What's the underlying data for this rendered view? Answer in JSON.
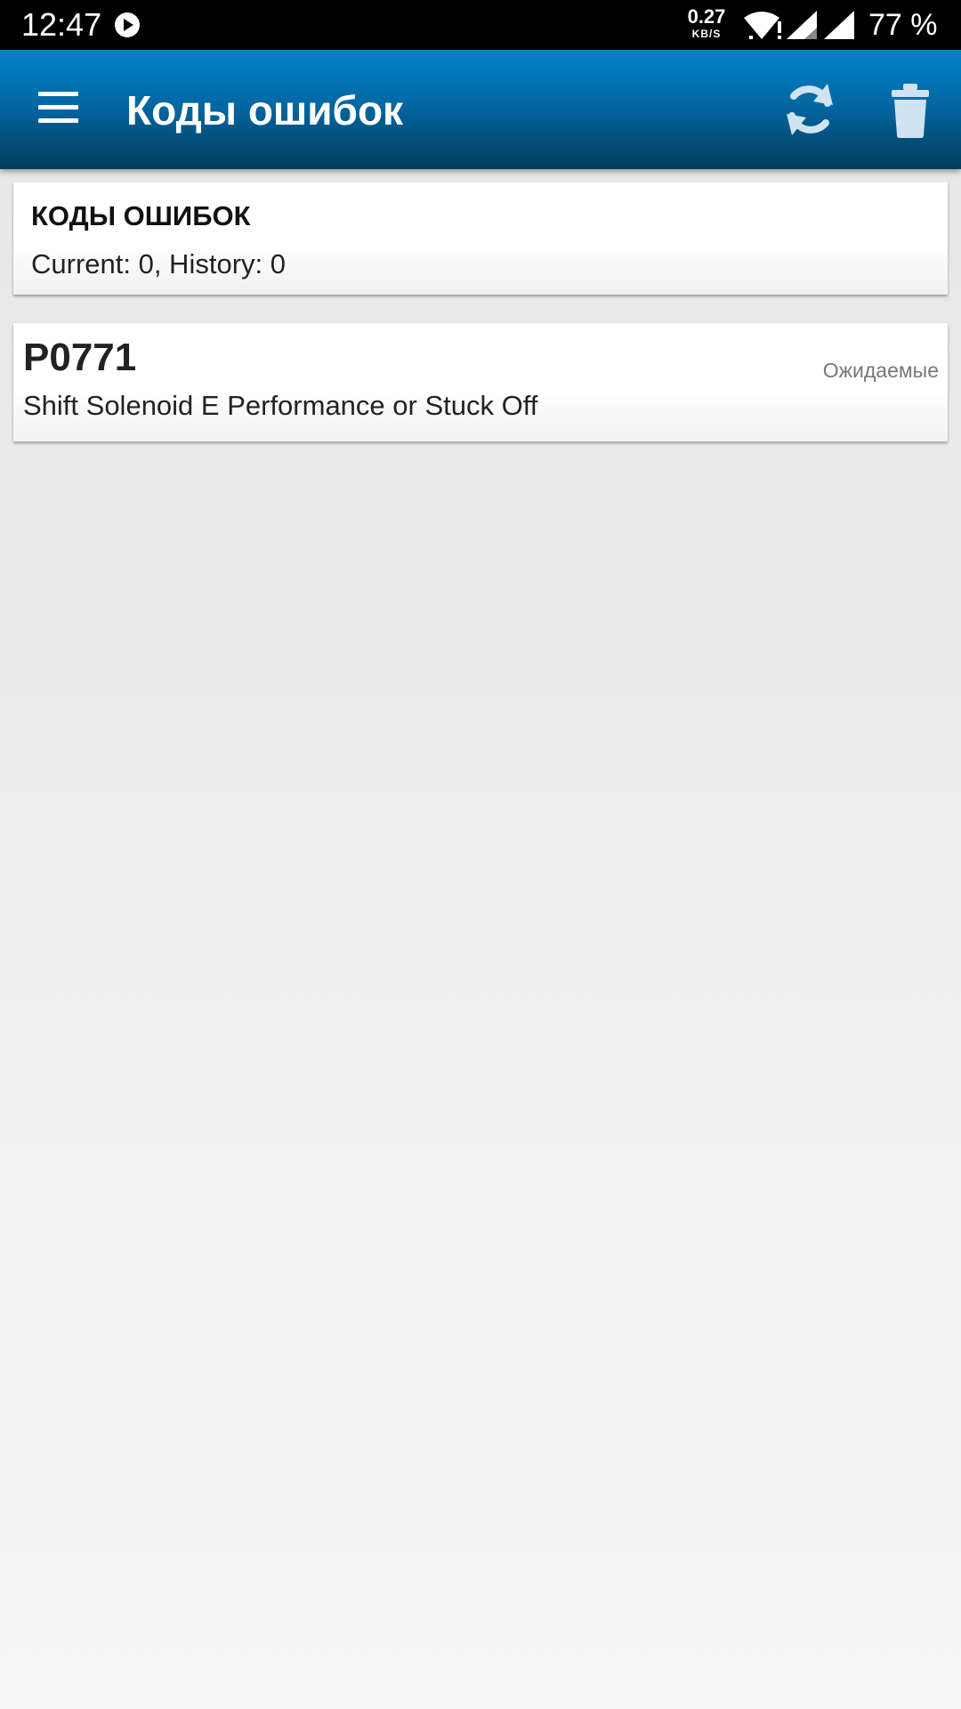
{
  "status_bar": {
    "time": "12:47",
    "speed_value": "0.27",
    "speed_unit": "KB/S",
    "battery": "77 %",
    "icons": [
      "play-icon",
      "wifi-icon",
      "signal-icon",
      "signal-icon"
    ]
  },
  "app_bar": {
    "title": "Коды ошибок",
    "icons": [
      "menu-icon",
      "refresh-icon",
      "trash-icon"
    ],
    "colors": {
      "bar_top": "#0283c8",
      "bar_bottom": "#033c5e"
    }
  },
  "summary": {
    "title": "КОДЫ ОШИБОК",
    "counts": "Current: 0, History: 0"
  },
  "dtc_list": [
    {
      "code": "P0771",
      "status": "Ожидаемые",
      "description": "Shift Solenoid E Performance or Stuck Off"
    }
  ]
}
